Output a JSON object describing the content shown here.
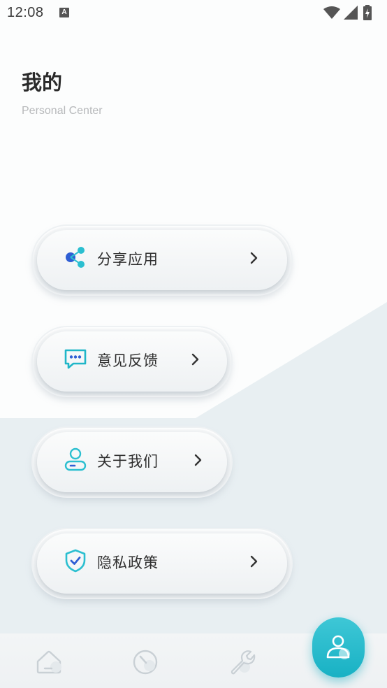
{
  "status_bar": {
    "time": "12:08",
    "indicator_letter": "A",
    "icons": [
      "wifi-icon",
      "cellular-signal-icon",
      "battery-charging-icon"
    ]
  },
  "header": {
    "title": "我的",
    "subtitle": "Personal Center"
  },
  "menu": [
    {
      "label": "分享应用",
      "icon": "share-icon",
      "chevron": ">"
    },
    {
      "label": "意见反馈",
      "icon": "feedback-chat-icon",
      "chevron": ">"
    },
    {
      "label": "关于我们",
      "icon": "about-user-icon",
      "chevron": ">"
    },
    {
      "label": "隐私政策",
      "icon": "privacy-shield-icon",
      "chevron": ">"
    }
  ],
  "bottom_nav": {
    "tabs": [
      {
        "icon": "home-icon",
        "active": false
      },
      {
        "icon": "speedometer-icon",
        "active": false
      },
      {
        "icon": "wrench-icon",
        "active": false
      },
      {
        "icon": "profile-icon",
        "active": true
      }
    ]
  },
  "colors": {
    "accent": "#1fb6c8",
    "icon_blue": "#2f67d8",
    "background_diagonal": "#e7eff1"
  }
}
